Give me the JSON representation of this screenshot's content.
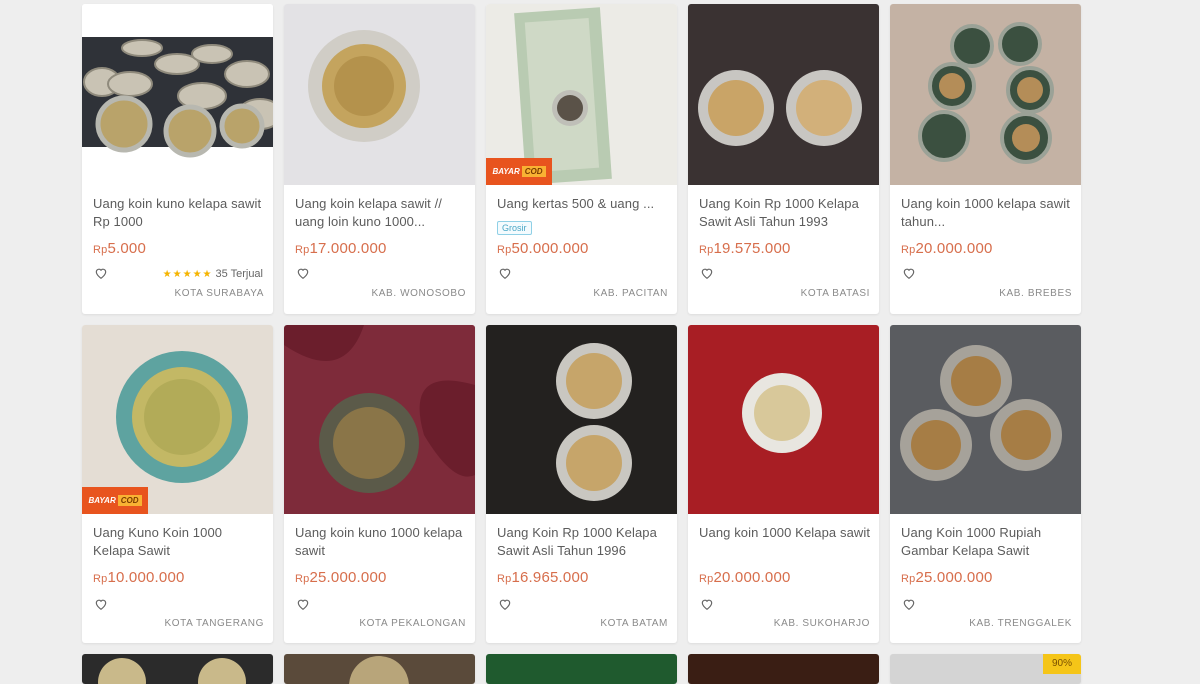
{
  "products": [
    {
      "title": "Uang koin kuno kelapa sawit Rp 1000",
      "currency": "Rp",
      "price": "5.000",
      "location": "KOTA SURABAYA",
      "rating_stars": "★★★★★",
      "sold": "35 Terjual"
    },
    {
      "title": "Uang koin kelapa sawit // uang loin kuno 1000...",
      "currency": "Rp",
      "price": "17.000.000",
      "location": "KAB. WONOSOBO"
    },
    {
      "title": "Uang kertas 500 & uang ...",
      "currency": "Rp",
      "price": "50.000.000",
      "location": "KAB. PACITAN",
      "tag": "Grosir",
      "badge": "COD"
    },
    {
      "title": "Uang Koin Rp 1000 Kelapa Sawit Asli Tahun 1993",
      "currency": "Rp",
      "price": "19.575.000",
      "location": "KOTA BATASI"
    },
    {
      "title": "Uang koin 1000 kelapa sawit tahun...",
      "currency": "Rp",
      "price": "20.000.000",
      "location": "KAB. BREBES"
    },
    {
      "title": "Uang Kuno Koin 1000 Kelapa Sawit",
      "currency": "Rp",
      "price": "10.000.000",
      "location": "KOTA TANGERANG",
      "badge": "COD"
    },
    {
      "title": "Uang koin kuno 1000 kelapa sawit",
      "currency": "Rp",
      "price": "25.000.000",
      "location": "KOTA PEKALONGAN"
    },
    {
      "title": "Uang Koin Rp 1000 Kelapa Sawit Asli Tahun 1996",
      "currency": "Rp",
      "price": "16.965.000",
      "location": "KOTA BATAM"
    },
    {
      "title": "Uang koin 1000 Kelapa sawit",
      "currency": "Rp",
      "price": "20.000.000",
      "location": "KAB. SUKOHARJO"
    },
    {
      "title": "Uang Koin 1000 Rupiah Gambar Kelapa Sawit",
      "currency": "Rp",
      "price": "25.000.000",
      "location": "KAB. TRENGGALEK"
    }
  ],
  "bottom_row": [
    {
      "label": ""
    },
    {
      "label": ""
    },
    {
      "label": ""
    },
    {
      "label": ""
    },
    {
      "label": "90%"
    }
  ]
}
